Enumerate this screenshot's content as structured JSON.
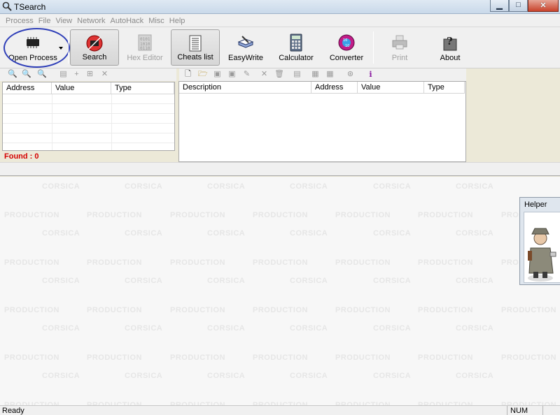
{
  "window": {
    "title": "TSearch"
  },
  "menu": [
    "Process",
    "File",
    "View",
    "Network",
    "AutoHack",
    "Misc",
    "Help"
  ],
  "toolbar": {
    "open_process": "Open Process",
    "search": "Search",
    "hex_editor": "Hex Editor",
    "cheats_list": "Cheats list",
    "easywrite": "EasyWrite",
    "calculator": "Calculator",
    "converter": "Converter",
    "print": "Print",
    "about": "About"
  },
  "left_table": {
    "columns": [
      "Address",
      "Value",
      "Type"
    ]
  },
  "right_table": {
    "columns": [
      "Description",
      "Address",
      "Value",
      "Type"
    ]
  },
  "found_label": "Found : 0",
  "watermark": {
    "word1": "CORSICA",
    "word2": "PRODUCTION"
  },
  "helper": {
    "title": "Helper"
  },
  "status": {
    "text": "Ready",
    "num": "NUM"
  },
  "colors": {
    "found_text": "#d40000",
    "annotation_circle": "#2f3fb8"
  }
}
